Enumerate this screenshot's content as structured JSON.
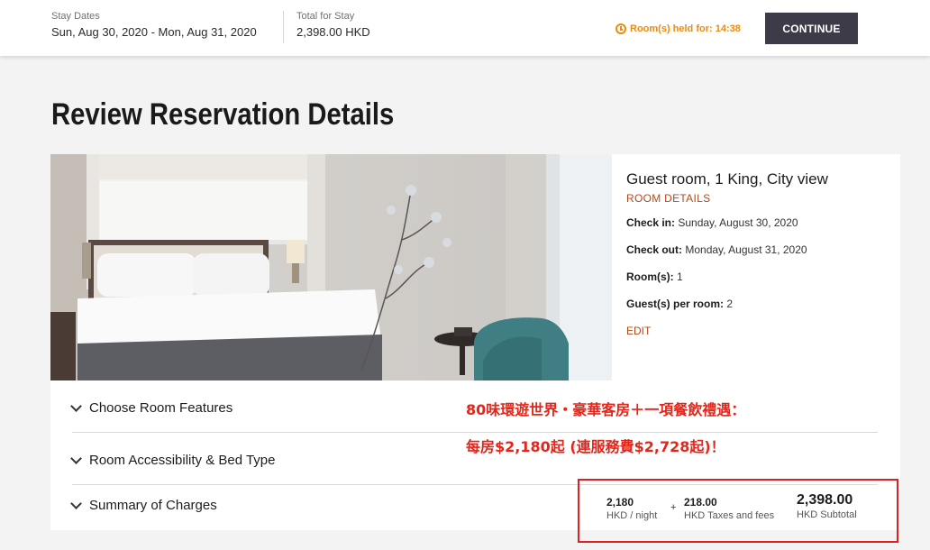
{
  "header": {
    "stay_label": "Stay Dates",
    "stay_value": "Sun, Aug 30, 2020 - Mon, Aug 31, 2020",
    "total_label": "Total for Stay",
    "total_value": "2,398.00 HKD",
    "held_text": "Room(s) held for: 14:38",
    "continue_label": "CONTINUE"
  },
  "page_title": "Review Reservation Details",
  "room": {
    "name": "Guest room, 1 King, City view",
    "details_link": "ROOM DETAILS",
    "checkin_label": "Check in:",
    "checkin_value": "Sunday, August 30, 2020",
    "checkout_label": "Check out:",
    "checkout_value": "Monday, August 31, 2020",
    "rooms_label": "Room(s):",
    "rooms_value": "1",
    "guests_label": "Guest(s) per room:",
    "guests_value": "2",
    "edit_label": "EDIT"
  },
  "accordion": {
    "features": "Choose Room Features",
    "accessibility": "Room Accessibility & Bed Type",
    "summary": "Summary of Charges"
  },
  "promo": {
    "line1": "80味環遊世界・豪華客房＋一項餐飲禮遇：",
    "line2": "每房$2,180起 (連服務費$2,728起)！"
  },
  "charges": {
    "nightly_value": "2,180",
    "nightly_label": "HKD / night",
    "plus": "+",
    "tax_value": "218.00",
    "tax_label": "HKD Taxes and fees",
    "subtotal_value": "2,398.00",
    "subtotal_label": "HKD Subtotal"
  },
  "colors": {
    "accent": "#b04a1e",
    "timer": "#f08a0c",
    "button": "#3d3b47",
    "promo": "#e4251a"
  }
}
